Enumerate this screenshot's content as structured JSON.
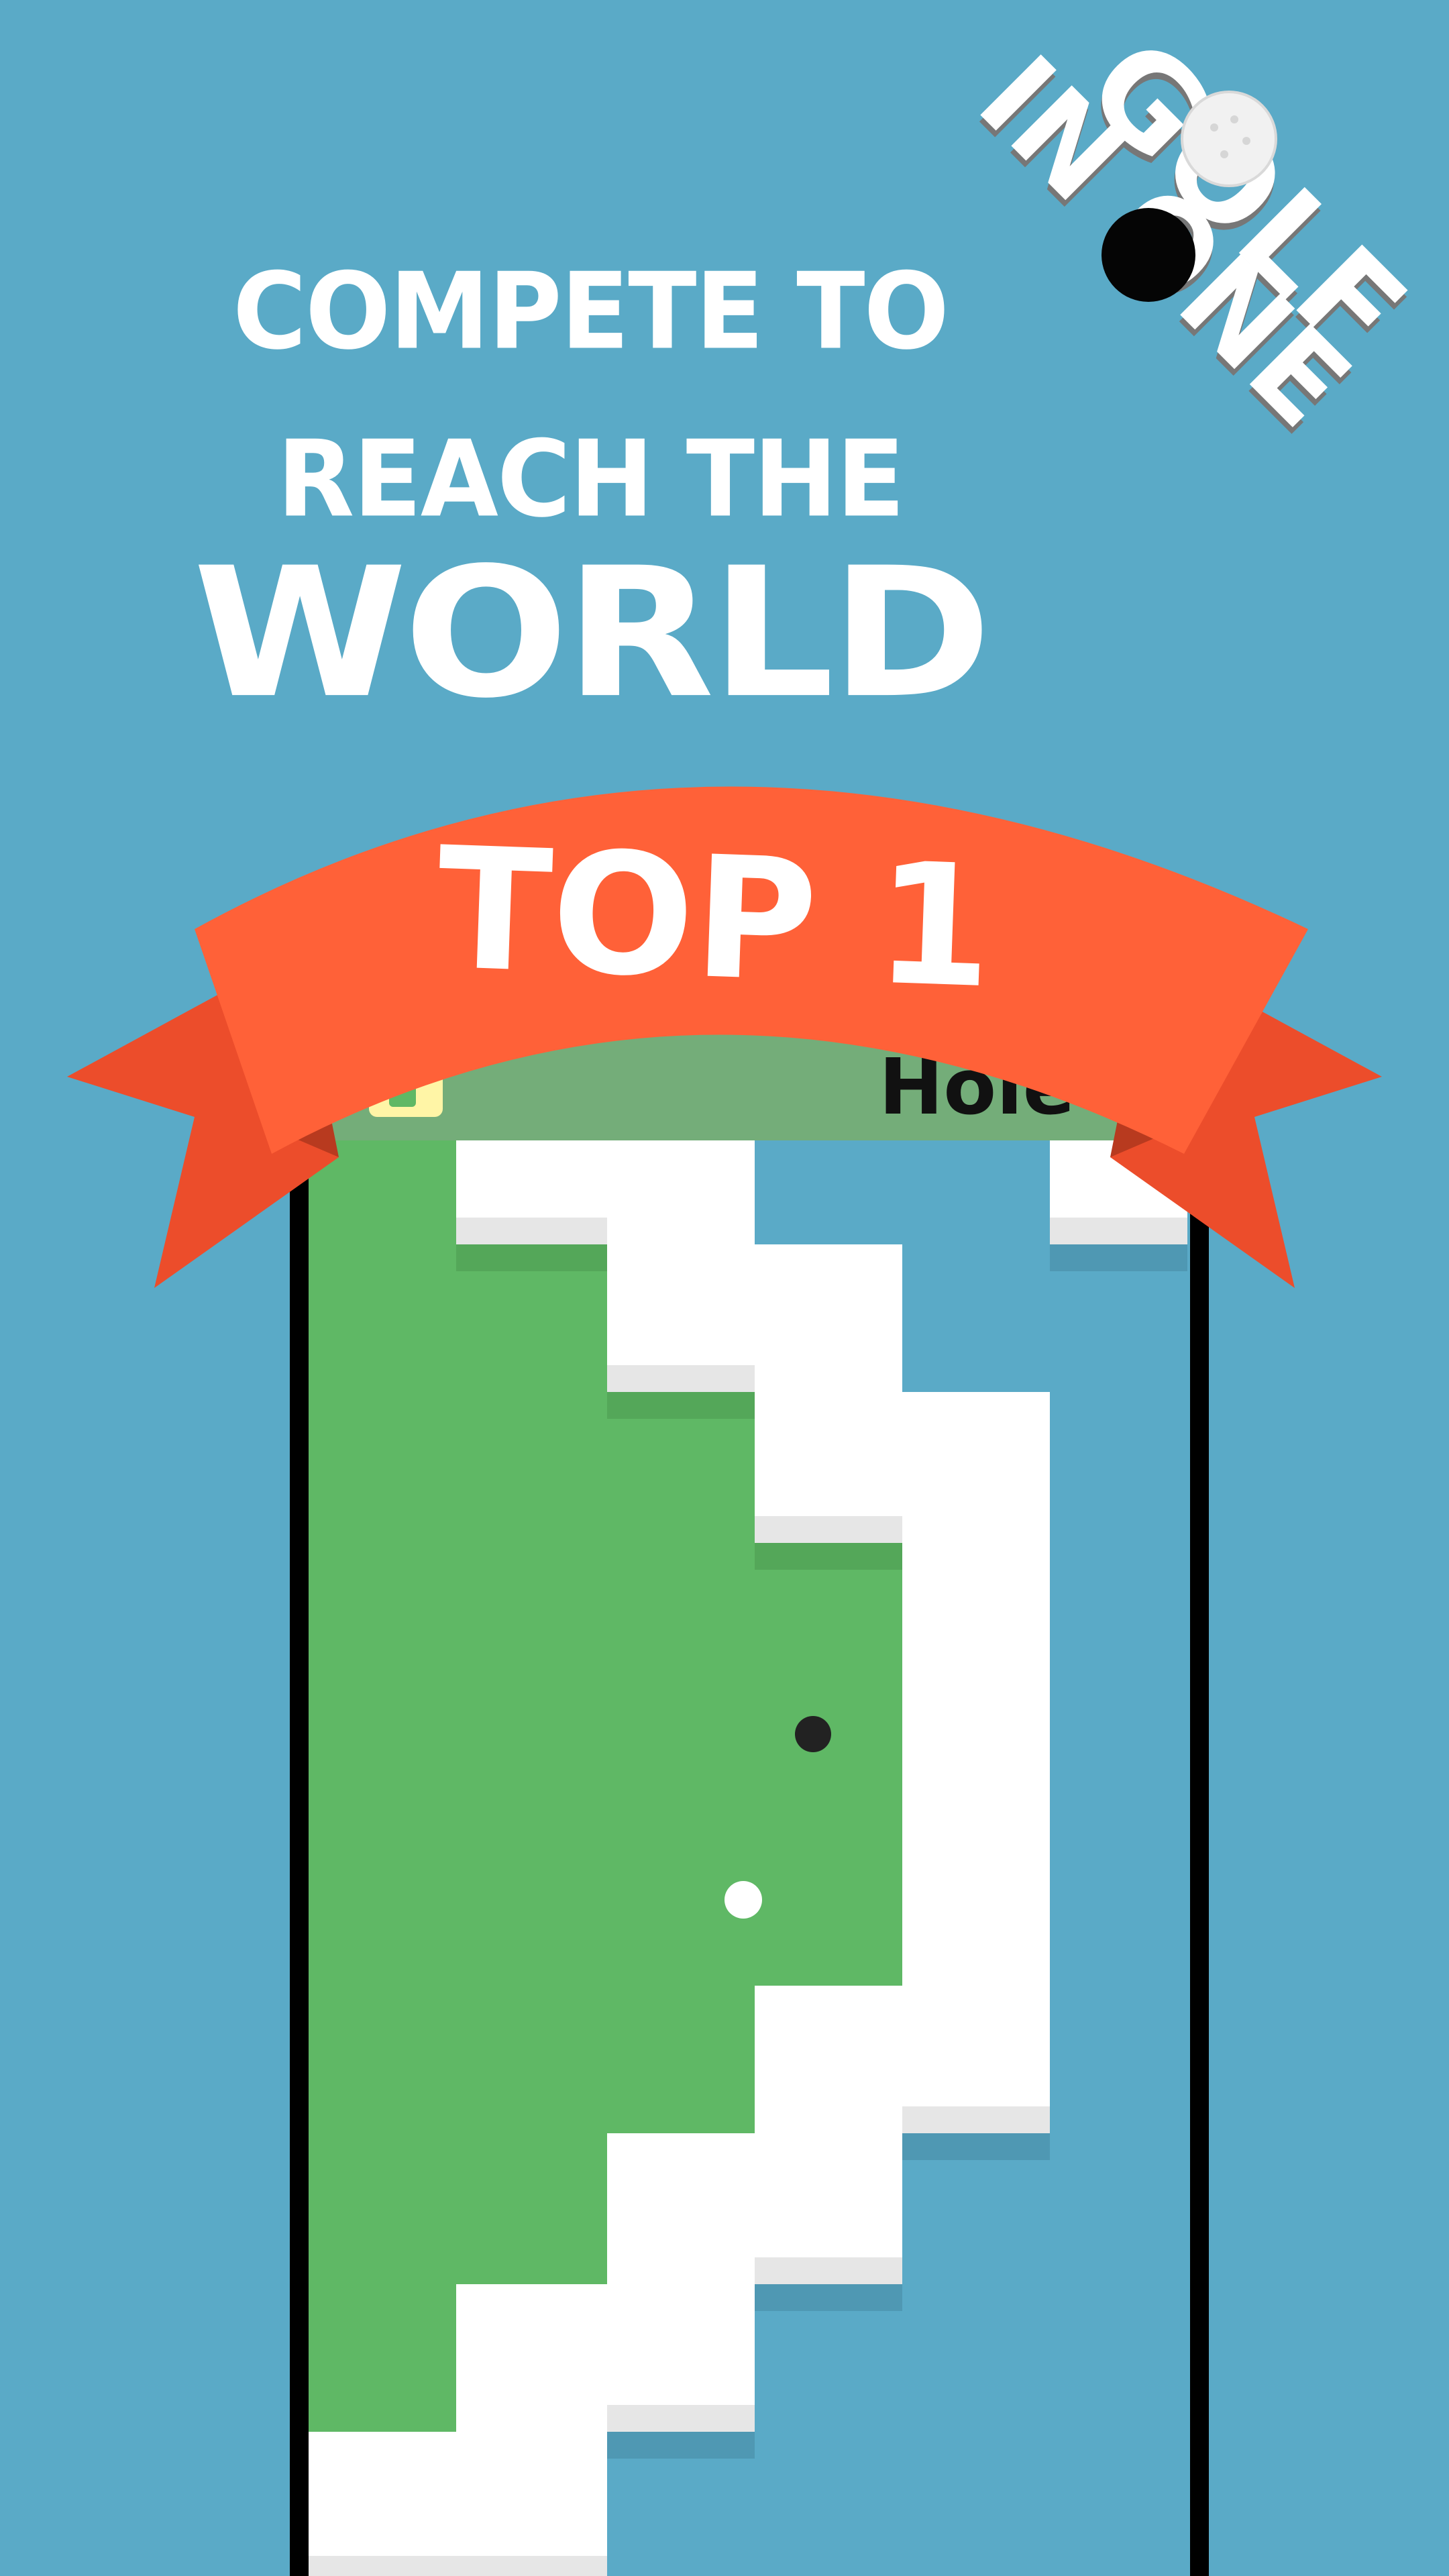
{
  "headline": {
    "line1": "COMPETE TO",
    "line2": "REACH THE",
    "line3": "WORLD"
  },
  "banner": {
    "text": "TOP 1"
  },
  "logo": {
    "word1": "GOLF",
    "word2": "IN ONE"
  },
  "game": {
    "top_bar_text": "Hole"
  },
  "colors": {
    "background": "#5aaac7",
    "grass": "#5fb865",
    "wall": "#ffffff",
    "ribbon": "#ff6138",
    "ribbon_tail": "#ec4d2b",
    "ball": "#ffffff",
    "hole": "#222222",
    "phone_frame": "#000000"
  },
  "icons": {
    "top_bar_button": "gear-icon",
    "logo_ball": "golf-ball-icon",
    "logo_hole": "golf-hole-icon"
  }
}
